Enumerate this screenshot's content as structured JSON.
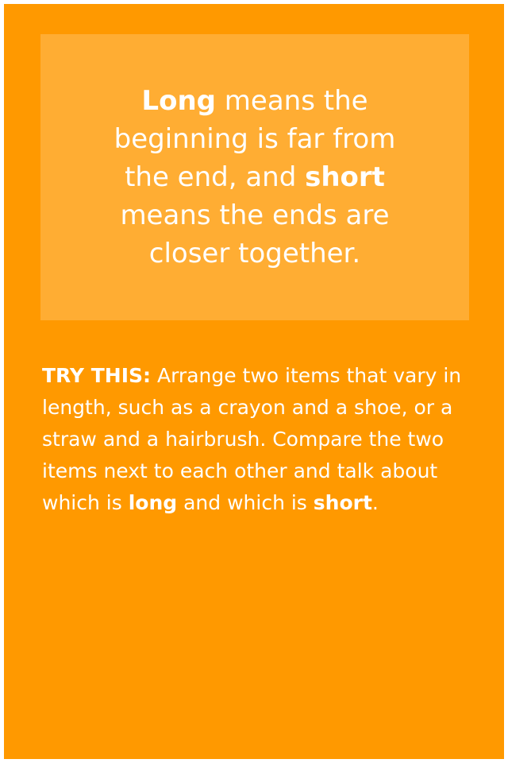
{
  "definition": {
    "long_word": "Long",
    "part1": " means the beginning is far from the end, and ",
    "short_word": "short",
    "part2": " means the ends are closer together."
  },
  "try_this": {
    "label": "TRY THIS:",
    "part1": " Arrange two items that vary in length, such as a crayon and a shoe, or a straw and a hairbrush. Compare the two items next to each other and talk about which is ",
    "long_word": "long",
    "part2": " and which is ",
    "short_word": "short",
    "part3": "."
  },
  "colors": {
    "page_background": "#ff9900",
    "definition_box": "#ffad33",
    "text": "#ffffff"
  }
}
